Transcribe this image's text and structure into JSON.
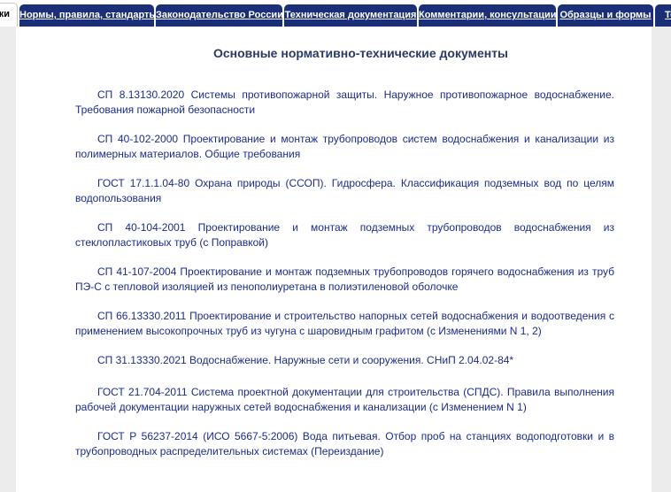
{
  "tabs": [
    {
      "label": "ки",
      "active": true
    },
    {
      "label": "Нормы, правила, стандарты"
    },
    {
      "label": "Законодательство России"
    },
    {
      "label": "Техническая документация"
    },
    {
      "label": "Комментарии, консультации"
    },
    {
      "label": "Образцы и формы"
    },
    {
      "label": "Те"
    }
  ],
  "page_title": "Основные нормативно-технические документы",
  "documents": [
    "СП 8.13130.2020 Системы противопожарной защиты. Наружное противопожарное водоснабжение. Требования пожарной безопасности",
    "СП 40-102-2000 Проектирование и монтаж трубопроводов систем водоснабжения и канализации из полимерных материалов. Общие требования",
    "ГОСТ 17.1.1.04-80 Охрана природы (ССОП). Гидросфера. Классификация подземных вод по целям водопользования",
    "СП 40-104-2001 Проектирование и монтаж подземных трубопроводов водоснабжения из стеклопластиковых труб (с Поправкой)",
    "СП 41-107-2004 Проектирование и монтаж подземных трубопроводов горячего водоснабжения из труб ПЭ-С с тепловой изоляцией из пенополиуретана в полиэтиленовой оболочке",
    "СП 66.13330.2011 Проектирование и строительство напорных сетей водоснабжения и водоотведения с применением высокопрочных труб из чугуна с шаровидным графитом (с Изменениями N 1, 2)",
    "СП 31.13330.2021 Водоснабжение. Наружные сети и сооружения. СНиП 2.04.02-84*",
    "ГОСТ 21.704-2011 Система проектной документации для строительства (СПДС). Правила выполнения рабочей документации наружных сетей водоснабжения и канализации (с Изменением N 1)",
    "ГОСТ Р 56237-2014 (ИСО 5667-5:2006) Вода питьевая. Отбор проб на станциях водоподготовки и в трубопроводных распределительных системах (Переиздание)"
  ]
}
